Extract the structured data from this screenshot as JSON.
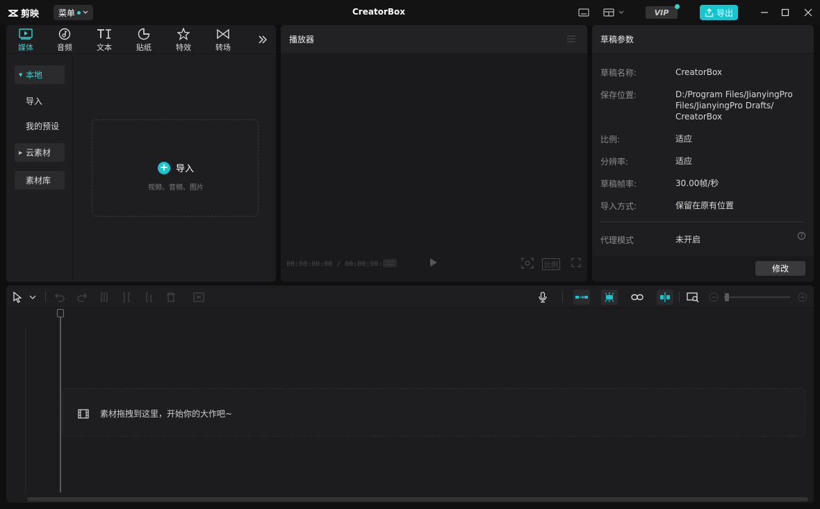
{
  "titlebar": {
    "logo_text": "剪映",
    "menu_label": "菜单",
    "app_title": "CreatorBox",
    "vip_label": "VIP",
    "export_label": "导出"
  },
  "media": {
    "tabs": [
      {
        "label": "媒体",
        "icon": "media-icon",
        "active": true
      },
      {
        "label": "音频",
        "icon": "audio-icon"
      },
      {
        "label": "文本",
        "icon": "text-icon"
      },
      {
        "label": "贴纸",
        "icon": "sticker-icon"
      },
      {
        "label": "特效",
        "icon": "effects-icon"
      },
      {
        "label": "转场",
        "icon": "transition-icon"
      }
    ],
    "sidebar": {
      "local": "本地",
      "import": "导入",
      "my_presets": "我的预设",
      "cloud": "云素材",
      "library": "素材库"
    },
    "drop_title": "导入",
    "drop_sub": "视频、音频、图片"
  },
  "player": {
    "title": "播放器",
    "timecode": "00:00:00:00 / 00:00:00:00",
    "ratio_label": "比例"
  },
  "draft": {
    "title": "草稿参数",
    "rows": [
      {
        "label": "草稿名称:",
        "value": "CreatorBox"
      },
      {
        "label": "保存位置:",
        "value": "D:/Program Files/JianyingPro Files/JianyingPro Drafts/ CreatorBox"
      },
      {
        "label": "比例:",
        "value": "适应"
      },
      {
        "label": "分辨率:",
        "value": "适应"
      },
      {
        "label": "草稿帧率:",
        "value": "30.00帧/秒"
      },
      {
        "label": "导入方式:",
        "value": "保留在原有位置"
      }
    ],
    "proxy_label": "代理模式",
    "proxy_value": "未开启",
    "modify_label": "修改"
  },
  "timeline": {
    "drop_tip": "素材拖拽到这里，开始你的大作吧~"
  },
  "colors": {
    "accent": "#14c6d1",
    "background": "#0f0f10",
    "panel": "#1e1e20"
  }
}
